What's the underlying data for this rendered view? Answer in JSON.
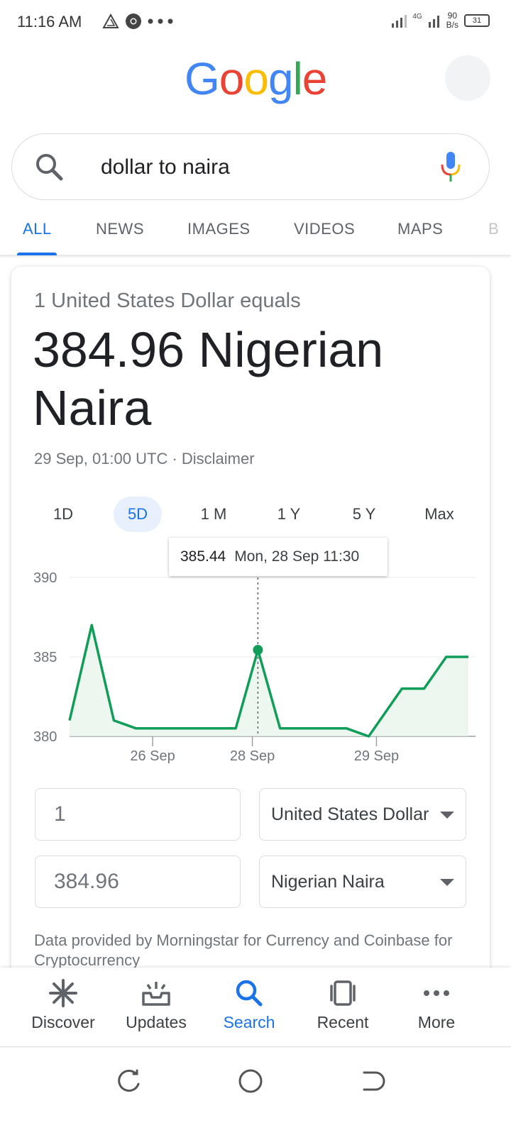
{
  "status_bar": {
    "time": "11:16 AM",
    "network": "4G",
    "net_speed_value": "90",
    "net_speed_unit": "B/s",
    "battery": "31"
  },
  "header": {
    "logo_text": "Google",
    "logo_colors": [
      "#4285F4",
      "#EA4335",
      "#FBBC05",
      "#4285F4",
      "#34A853",
      "#EA4335"
    ]
  },
  "search": {
    "query": "dollar to naira"
  },
  "tabs": [
    {
      "label": "ALL",
      "active": true
    },
    {
      "label": "NEWS",
      "active": false
    },
    {
      "label": "IMAGES",
      "active": false
    },
    {
      "label": "VIDEOS",
      "active": false
    },
    {
      "label": "MAPS",
      "active": false
    },
    {
      "label": "B",
      "active": false
    }
  ],
  "converter": {
    "equals_label": "1 United States Dollar equals",
    "result": "384.96 Nigerian Naira",
    "timestamp": "29 Sep, 01:00 UTC · Disclaimer",
    "ranges": [
      {
        "label": "1D",
        "active": false
      },
      {
        "label": "5D",
        "active": true
      },
      {
        "label": "1 M",
        "active": false
      },
      {
        "label": "1 Y",
        "active": false
      },
      {
        "label": "5 Y",
        "active": false
      },
      {
        "label": "Max",
        "active": false
      }
    ],
    "tooltip": {
      "value": "385.44",
      "date": "Mon, 28 Sep 11:30"
    },
    "from_amount": "1",
    "from_currency": "United States Dollar",
    "to_amount": "384.96",
    "to_currency": "Nigerian Naira",
    "attribution": "Data provided by Morningstar for Currency and Coinbase for Cryptocurrency"
  },
  "chart_data": {
    "type": "line",
    "x": [
      0,
      0.2,
      0.4,
      0.6,
      1.0,
      1.5,
      1.7,
      1.9,
      2.1,
      2.5,
      2.7,
      3.0,
      3.2,
      3.4,
      3.6
    ],
    "y": [
      381.0,
      387.0,
      381.0,
      380.5,
      380.5,
      380.5,
      385.44,
      380.5,
      380.5,
      380.5,
      380.0,
      383.0,
      383.0,
      385.0,
      385.0
    ],
    "x_ticks": [
      {
        "pos": 0.75,
        "label": "26 Sep"
      },
      {
        "pos": 1.65,
        "label": "28 Sep"
      },
      {
        "pos": 2.77,
        "label": "29 Sep"
      }
    ],
    "y_ticks": [
      380,
      385,
      390
    ],
    "ylim": [
      380,
      390
    ],
    "highlight_index": 6,
    "line_color": "#0f9d58",
    "fill_color": "#e6f4ea",
    "grid": true
  },
  "bottom_nav": [
    {
      "label": "Discover",
      "icon": "asterisk-icon",
      "active": false
    },
    {
      "label": "Updates",
      "icon": "inbox-icon",
      "active": false
    },
    {
      "label": "Search",
      "icon": "search-icon",
      "active": true
    },
    {
      "label": "Recent",
      "icon": "recent-cards-icon",
      "active": false
    },
    {
      "label": "More",
      "icon": "more-dots-icon",
      "active": false
    }
  ]
}
